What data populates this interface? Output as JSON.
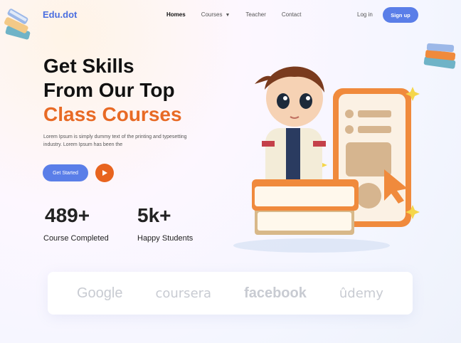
{
  "brand": {
    "name": "Edu.dot"
  },
  "nav": {
    "items": [
      {
        "label": "Homes",
        "active": true
      },
      {
        "label": "Courses",
        "dropdown": true
      },
      {
        "label": "Teacher"
      },
      {
        "label": "Contact"
      }
    ],
    "login_label": "Log in",
    "signup_label": "Sign up"
  },
  "hero": {
    "title_line1": "Get Skills",
    "title_line2": "From Our Top",
    "title_line3": "Class Courses",
    "description": "Lorem Ipsum is simply dummy text of the printing and typesetting industry. Lorem Ipsum has been the",
    "cta_label": "Get Started"
  },
  "stats": [
    {
      "value": "489+",
      "label": "Course Completed"
    },
    {
      "value": "5k+",
      "label": "Happy Students"
    }
  ],
  "partners": [
    "Google",
    "coursera",
    "facebook",
    "ûdemy"
  ],
  "colors": {
    "primary": "#5a7ee8",
    "accent": "#e86a25",
    "brand": "#4a6ee0"
  }
}
